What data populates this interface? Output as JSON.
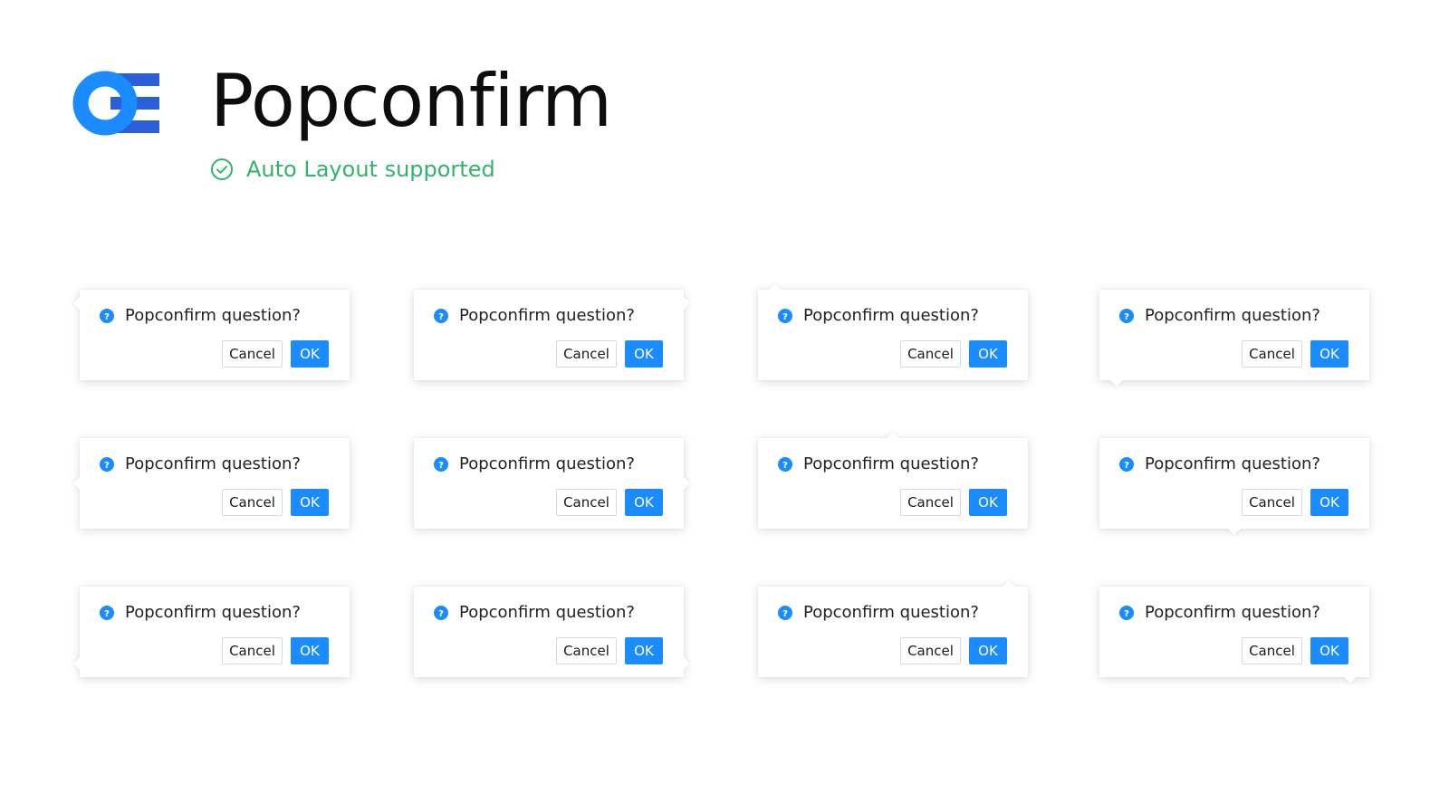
{
  "header": {
    "title": "Popconfirm",
    "subtitle": "Auto Layout supported",
    "logo_icon": "oe-logo-icon",
    "check_icon": "check-circle-icon"
  },
  "colors": {
    "accent": "#1a8cff",
    "logo_blue": "#1a8cff",
    "logo_dark_blue": "#2b5fd9",
    "success": "#34b36b"
  },
  "popconfirms": [
    {
      "placement": "left-top",
      "question": "Popconfirm question?",
      "icon": "question-circle-icon",
      "cancel_label": "Cancel",
      "ok_label": "OK"
    },
    {
      "placement": "right-top",
      "question": "Popconfirm question?",
      "icon": "question-circle-icon",
      "cancel_label": "Cancel",
      "ok_label": "OK"
    },
    {
      "placement": "top-left",
      "question": "Popconfirm question?",
      "icon": "question-circle-icon",
      "cancel_label": "Cancel",
      "ok_label": "OK"
    },
    {
      "placement": "bottom-left",
      "question": "Popconfirm question?",
      "icon": "question-circle-icon",
      "cancel_label": "Cancel",
      "ok_label": "OK"
    },
    {
      "placement": "left",
      "question": "Popconfirm question?",
      "icon": "question-circle-icon",
      "cancel_label": "Cancel",
      "ok_label": "OK"
    },
    {
      "placement": "right",
      "question": "Popconfirm question?",
      "icon": "question-circle-icon",
      "cancel_label": "Cancel",
      "ok_label": "OK"
    },
    {
      "placement": "top",
      "question": "Popconfirm question?",
      "icon": "question-circle-icon",
      "cancel_label": "Cancel",
      "ok_label": "OK"
    },
    {
      "placement": "bottom",
      "question": "Popconfirm question?",
      "icon": "question-circle-icon",
      "cancel_label": "Cancel",
      "ok_label": "OK"
    },
    {
      "placement": "left-bottom",
      "question": "Popconfirm question?",
      "icon": "question-circle-icon",
      "cancel_label": "Cancel",
      "ok_label": "OK"
    },
    {
      "placement": "right-bottom",
      "question": "Popconfirm question?",
      "icon": "question-circle-icon",
      "cancel_label": "Cancel",
      "ok_label": "OK"
    },
    {
      "placement": "top-right",
      "question": "Popconfirm question?",
      "icon": "question-circle-icon",
      "cancel_label": "Cancel",
      "ok_label": "OK"
    },
    {
      "placement": "bottom-right",
      "question": "Popconfirm question?",
      "icon": "question-circle-icon",
      "cancel_label": "Cancel",
      "ok_label": "OK"
    }
  ]
}
